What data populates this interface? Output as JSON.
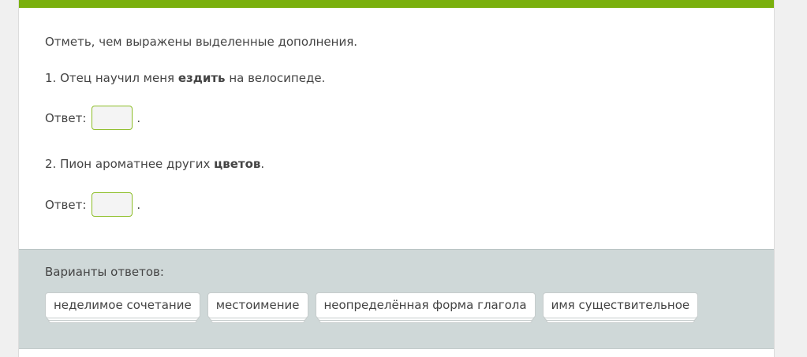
{
  "colors": {
    "accent_bar": "#7ab00d",
    "drop_border": "#8cbd26",
    "options_bg": "#cfd8d8"
  },
  "task": {
    "instruction": "Отметь, чем выражены выделенные дополнения.",
    "questions": [
      {
        "number": "1.",
        "before": "Отец научил меня",
        "highlight": "ездить",
        "after": "на велосипеде.",
        "answer_label": "Ответ:",
        "answer_value": "",
        "answer_end": "."
      },
      {
        "number": "2.",
        "before": "Пион ароматнее других",
        "highlight": "цветов",
        "after": ".",
        "answer_label": "Ответ:",
        "answer_value": "",
        "answer_end": "."
      }
    ]
  },
  "options": {
    "title": "Варианты ответов:",
    "items": [
      "неделимое сочетание",
      "местоимение",
      "неопределённая форма глагола",
      "имя существительное"
    ]
  }
}
